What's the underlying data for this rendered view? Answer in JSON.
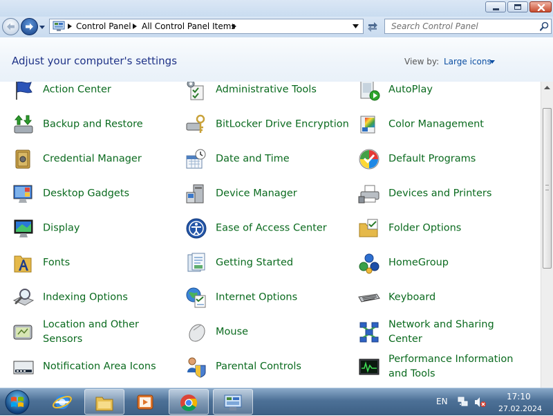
{
  "address_bar": {
    "crumbs": [
      "Control Panel",
      "All Control Panel Items"
    ]
  },
  "search": {
    "placeholder": "Search Control Panel"
  },
  "header": {
    "title": "Adjust your computer's settings",
    "view_by_label": "View by:",
    "view_by_value": "Large icons"
  },
  "items": [
    {
      "label": "Action Center",
      "icon": "flag-icon"
    },
    {
      "label": "Administrative Tools",
      "icon": "admin-tools-icon"
    },
    {
      "label": "AutoPlay",
      "icon": "autoplay-icon"
    },
    {
      "label": "Backup and Restore",
      "icon": "backup-icon"
    },
    {
      "label": "BitLocker Drive Encryption",
      "icon": "bitlocker-icon"
    },
    {
      "label": "Color Management",
      "icon": "color-management-icon"
    },
    {
      "label": "Credential Manager",
      "icon": "vault-icon"
    },
    {
      "label": "Date and Time",
      "icon": "calendar-clock-icon"
    },
    {
      "label": "Default Programs",
      "icon": "default-programs-icon"
    },
    {
      "label": "Desktop Gadgets",
      "icon": "gadgets-icon"
    },
    {
      "label": "Device Manager",
      "icon": "device-manager-icon"
    },
    {
      "label": "Devices and Printers",
      "icon": "printer-icon"
    },
    {
      "label": "Display",
      "icon": "display-icon"
    },
    {
      "label": "Ease of Access Center",
      "icon": "ease-of-access-icon"
    },
    {
      "label": "Folder Options",
      "icon": "folder-options-icon"
    },
    {
      "label": "Fonts",
      "icon": "fonts-icon"
    },
    {
      "label": "Getting Started",
      "icon": "getting-started-icon"
    },
    {
      "label": "HomeGroup",
      "icon": "homegroup-icon"
    },
    {
      "label": "Indexing Options",
      "icon": "indexing-icon"
    },
    {
      "label": "Internet Options",
      "icon": "internet-options-icon"
    },
    {
      "label": "Keyboard",
      "icon": "keyboard-icon"
    },
    {
      "label": "Location and Other Sensors",
      "icon": "location-sensor-icon"
    },
    {
      "label": "Mouse",
      "icon": "mouse-icon"
    },
    {
      "label": "Network and Sharing Center",
      "icon": "network-icon"
    },
    {
      "label": "Notification Area Icons",
      "icon": "notification-icon"
    },
    {
      "label": "Parental Controls",
      "icon": "parental-controls-icon"
    },
    {
      "label": "Performance Information and Tools",
      "icon": "performance-icon"
    }
  ],
  "taskbar": {
    "apps": [
      {
        "name": "internet-explorer",
        "active": false
      },
      {
        "name": "file-explorer",
        "active": true
      },
      {
        "name": "media-player",
        "active": false
      },
      {
        "name": "chrome",
        "active": true
      },
      {
        "name": "control-panel",
        "active": true
      }
    ],
    "language": "EN",
    "time": "17:10",
    "date": "27.02.2024"
  },
  "colors": {
    "link_green": "#0a6a1e",
    "title_blue": "#1e3287",
    "view_by_blue": "#0b4ea2"
  }
}
